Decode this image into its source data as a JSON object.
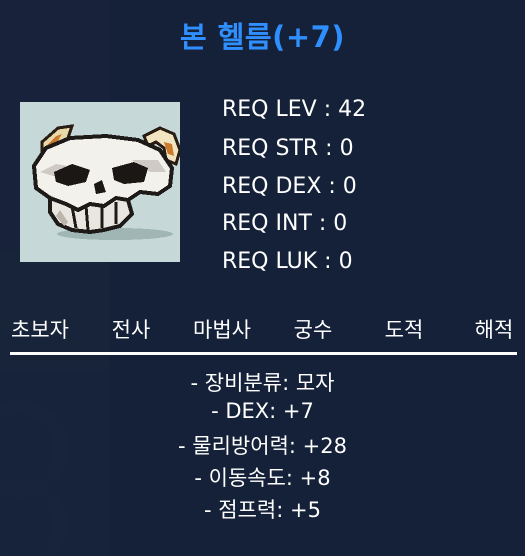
{
  "item": {
    "name": "본 헬름(+7)",
    "icon": "bone-helm-skull-icon"
  },
  "requirements": [
    "REQ LEV : 42",
    "REQ STR : 0",
    "REQ DEX : 0",
    "REQ INT : 0",
    "REQ LUK : 0"
  ],
  "jobs": [
    "초보자",
    "전사",
    "마법사",
    "궁수",
    "도적",
    "해적"
  ],
  "stats": [
    "- 장비분류: 모자",
    "- DEX: +7",
    "- 물리방어력: +28",
    "- 이동속도: +8",
    "- 점프력: +5"
  ],
  "colors": {
    "title": "#2f8fff",
    "panel": "#16223a",
    "text": "#ffffff",
    "icon_background": "#c6d8d7"
  }
}
